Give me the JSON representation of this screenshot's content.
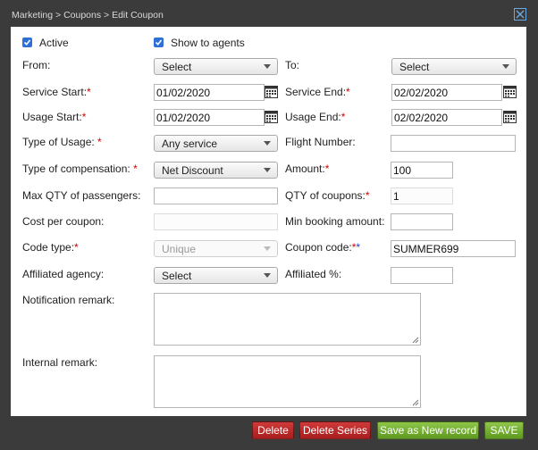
{
  "breadcrumb": "Marketing > Coupons > Edit Coupon",
  "colors": {
    "accent": "#2f6fd8",
    "required": "#d00000",
    "delete": "#b82a2a",
    "save": "#76b035"
  },
  "form": {
    "active_label": "Active",
    "active_checked": true,
    "show_agents_label": "Show to agents",
    "show_agents_checked": true,
    "from_label": "From:",
    "from_value": "Select",
    "to_label": "To:",
    "to_value": "Select",
    "service_start_label": "Service Start:",
    "service_start_value": "01/02/2020",
    "service_end_label": "Service End:",
    "service_end_value": "02/02/2020",
    "usage_start_label": "Usage Start:",
    "usage_start_value": "01/02/2020",
    "usage_end_label": "Usage End:",
    "usage_end_value": "02/02/2020",
    "type_usage_label": "Type of Usage: ",
    "type_usage_value": "Any service",
    "flight_number_label": "Flight Number:",
    "flight_number_value": "",
    "type_comp_label": "Type of compensation: ",
    "type_comp_value": "Net Discount",
    "amount_label": "Amount:",
    "amount_value": "100",
    "max_qty_label": "Max QTY of passengers:",
    "max_qty_value": "",
    "qty_coupons_label": "QTY of coupons:",
    "qty_coupons_value": "1",
    "cost_label": "Cost per coupon:",
    "cost_value": "",
    "min_booking_label": "Min booking amount:",
    "min_booking_value": "",
    "code_type_label": "Code type:",
    "code_type_value": "Unique",
    "coupon_code_label": "Coupon code:",
    "coupon_code_value": "SUMMER699",
    "aff_agency_label": "Affiliated agency:",
    "aff_agency_value": "Select",
    "aff_pct_label": "Affiliated %:",
    "aff_pct_value": "",
    "notification_label": "Notification remark:",
    "internal_label": "Internal remark:",
    "required_mark": "*"
  },
  "buttons": {
    "delete": "Delete",
    "delete_series": "Delete Series",
    "save_new": "Save as New record",
    "save": "SAVE"
  },
  "icons": {
    "close": "close-icon",
    "calendar": "calendar-icon",
    "check": "checkmark-icon",
    "dropdown": "chevron-down-icon",
    "resize": "resize-grip-icon"
  }
}
